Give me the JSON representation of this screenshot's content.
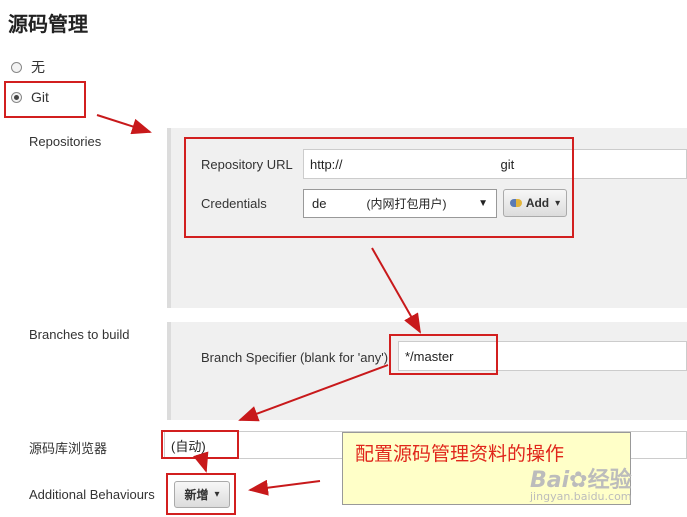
{
  "section_title": "源码管理",
  "scm_options": [
    {
      "label": "无",
      "selected": false
    },
    {
      "label": "Git",
      "selected": true
    }
  ],
  "repositories": {
    "label": "Repositories",
    "url_label": "Repository URL",
    "url_prefix": "http://",
    "url_suffix": "git",
    "credentials_label": "Credentials",
    "credentials_value_start": "de",
    "credentials_value_end": "(内网打包用户)",
    "add_button": "Add"
  },
  "branches": {
    "label": "Branches to build",
    "specifier_label": "Branch Specifier (blank for 'any')",
    "specifier_value": "*/master"
  },
  "browser": {
    "label": "源码库浏览器",
    "value": "(自动)"
  },
  "behaviours": {
    "label": "Additional Behaviours",
    "button": "新增"
  },
  "annotation": "配置源码管理资料的操作",
  "watermark": {
    "brand": "Bai",
    "brand_cn": "经验",
    "url": "jingyan.baidu.com"
  },
  "colors": {
    "annotation_red": "#e0261b",
    "panel_bg": "#f0f0f0",
    "annotation_bg": "#ffffc8"
  }
}
